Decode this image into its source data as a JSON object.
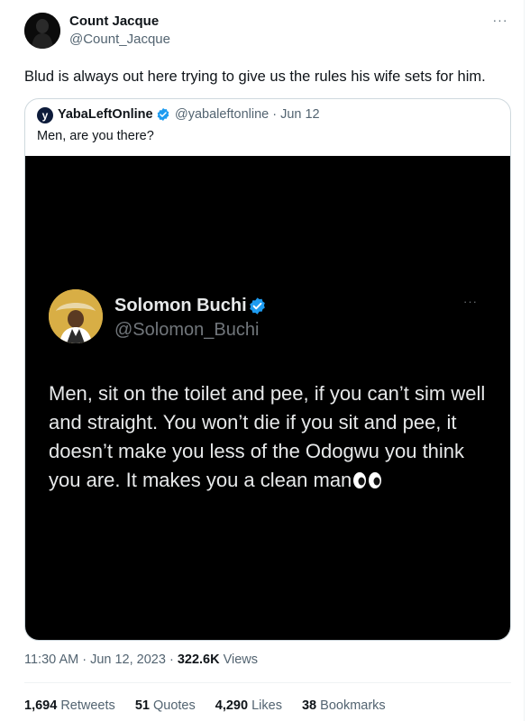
{
  "tweet": {
    "author_name": "Count Jacque",
    "author_handle": "@Count_Jacque",
    "more_label": "···",
    "text": "Blud is always out here trying to give us the rules his wife sets for him.",
    "logo_letter": "y",
    "timestamp": "11:30 AM · Jun 12, 2023 · ",
    "views_count": "322.6K",
    "views_label": " Views"
  },
  "quote": {
    "author_name": "YabaLeftOnline",
    "author_handle": "@yabaleftonline · Jun 12",
    "text": "Men, are you there?",
    "media": {
      "author_name": "Solomon Buchi",
      "author_handle": "@Solomon_Buchi",
      "more_label": "···",
      "text": "Men, sit on the toilet and pee, if you can’t sim well and straight. You won’t die if you sit and pee, it doesn’t make you less of the Odogwu you think you are. It makes you a clean man"
    }
  },
  "stats": {
    "retweets_count": "1,694",
    "retweets_label": " Retweets",
    "quotes_count": "51",
    "quotes_label": " Quotes",
    "likes_count": "4,290",
    "likes_label": " Likes",
    "bookmarks_count": "38",
    "bookmarks_label": " Bookmarks"
  },
  "colors": {
    "verified_blue": "#1d9bf0",
    "media_background": "#000000",
    "secondary_text": "#536471"
  },
  "icons": [
    "verified-badge-icon",
    "eyes-emoji-icon",
    "more-icon"
  ]
}
